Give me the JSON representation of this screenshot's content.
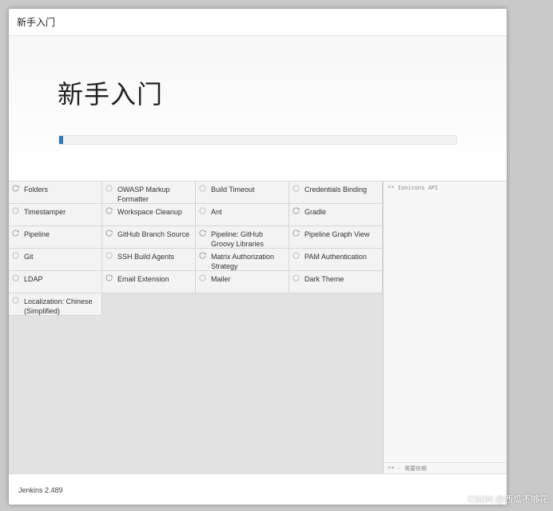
{
  "dialog": {
    "header_title": "新手入门"
  },
  "hero": {
    "title": "新手入门",
    "progress": 0.01
  },
  "plugins": [
    {
      "label": "Folders",
      "status": "pending"
    },
    {
      "label": "OWASP Markup Formatter",
      "status": "waiting"
    },
    {
      "label": "Build Timeout",
      "status": "waiting"
    },
    {
      "label": "Credentials Binding",
      "status": "waiting"
    },
    {
      "label": "Timestamper",
      "status": "waiting"
    },
    {
      "label": "Workspace Cleanup",
      "status": "pending"
    },
    {
      "label": "Ant",
      "status": "waiting"
    },
    {
      "label": "Gradle",
      "status": "pending"
    },
    {
      "label": "Pipeline",
      "status": "pending"
    },
    {
      "label": "GitHub Branch Source",
      "status": "pending"
    },
    {
      "label": "Pipeline: GitHub Groovy Libraries",
      "status": "pending"
    },
    {
      "label": "Pipeline Graph View",
      "status": "pending"
    },
    {
      "label": "Git",
      "status": "waiting"
    },
    {
      "label": "SSH Build Agents",
      "status": "waiting"
    },
    {
      "label": "Matrix Authorization Strategy",
      "status": "pending"
    },
    {
      "label": "PAM Authentication",
      "status": "waiting"
    },
    {
      "label": "LDAP",
      "status": "waiting"
    },
    {
      "label": "Email Extension",
      "status": "pending"
    },
    {
      "label": "Mailer",
      "status": "waiting"
    },
    {
      "label": "Dark Theme",
      "status": "waiting"
    },
    {
      "label": "Localization: Chinese (Simplified)",
      "status": "waiting"
    }
  ],
  "log": {
    "first_line": "** Ionicons API",
    "footer": "** - 需要依赖"
  },
  "footer": {
    "version": "Jenkins 2.489"
  },
  "watermark": "CSDN @西瓜不够花"
}
